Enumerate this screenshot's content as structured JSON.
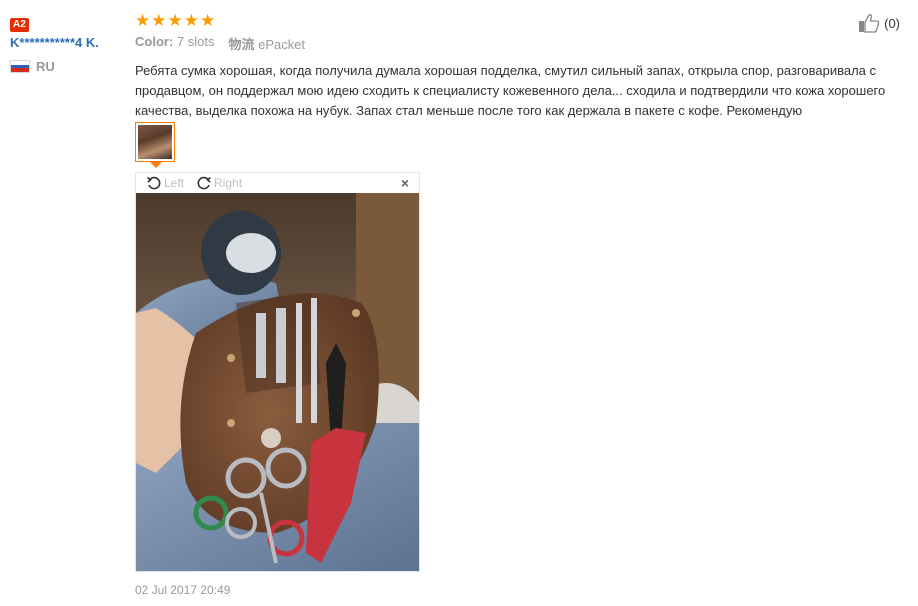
{
  "reviewer": {
    "level_badge": "A2",
    "name": "K***********4 K.",
    "country_code": "RU",
    "flag_colors": [
      "#ffffff",
      "#2f5fb8",
      "#d52b1e"
    ]
  },
  "review": {
    "stars": 5,
    "star_color": "#ff9a00",
    "color_label": "Color:",
    "color_value": "7 slots",
    "shipping_label": "物流",
    "shipping_value": "ePacket",
    "text": "Ребята сумка хорошая, когда получила думала хорошая подделка, смутил сильный запах, открыла спор, разговаривала с продавцом, он поддержал мою идею сходить к специалисту кожевенного дела... сходила и подтвердили что кожа хорошего качества, выделка похожа на нубук. Запах стал меньше после того как держала в пакете с кофе. Рекомендую",
    "date": "02 Jul 2017 20:49"
  },
  "viewer": {
    "rotate_left_label": "Left",
    "rotate_right_label": "Right",
    "close_label": "×"
  },
  "helpful": {
    "count": "(0)"
  },
  "accent_color": "#ff7d00"
}
